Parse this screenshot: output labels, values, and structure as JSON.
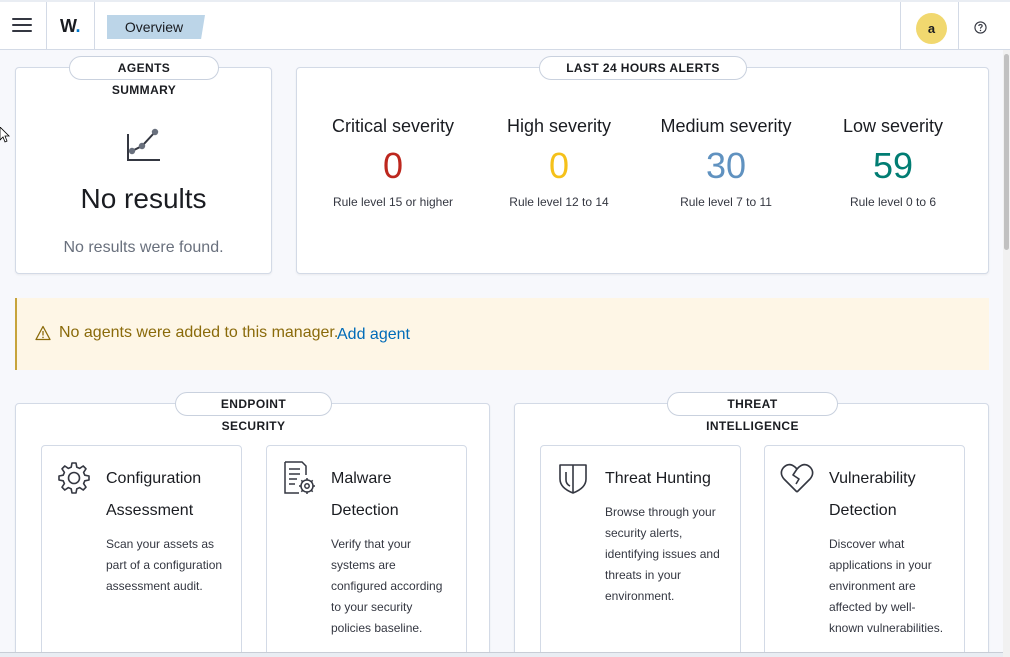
{
  "header": {
    "logo": "W",
    "logo_dot": ".",
    "breadcrumb": "Overview",
    "avatar_initial": "a",
    "menu_icon": "hamburger-icon",
    "help_icon": "help-icon"
  },
  "agents_summary": {
    "title": "AGENTS SUMMARY",
    "icon": "chart-line-icon",
    "heading": "No results",
    "message": "No results were found."
  },
  "alerts": {
    "title": "LAST 24 HOURS ALERTS",
    "items": [
      {
        "label": "Critical severity",
        "value": "0",
        "desc": "Rule level 15 or higher",
        "color": "#bd271e"
      },
      {
        "label": "High severity",
        "value": "0",
        "desc": "Rule level 12 to 14",
        "color": "#f5c11a"
      },
      {
        "label": "Medium severity",
        "value": "30",
        "desc": "Rule level 7 to 11",
        "color": "#6092c0"
      },
      {
        "label": "Low severity",
        "value": "59",
        "desc": "Rule level 0 to 6",
        "color": "#017d73"
      }
    ]
  },
  "callout": {
    "icon": "warning-icon",
    "text": "No agents were added to this manager.",
    "link": "Add agent"
  },
  "endpoint_security": {
    "title": "ENDPOINT SECURITY",
    "cards": [
      {
        "title_line1": "Configuration",
        "title_line2": "Assessment",
        "icon": "gear-icon",
        "desc": [
          "Scan your assets as",
          "part of a configuration",
          "assessment audit."
        ]
      },
      {
        "title_line1": "Malware",
        "title_line2": "Detection",
        "icon": "document-gear-icon",
        "desc": [
          "Verify that your",
          "systems are",
          "configured according",
          "to your security",
          "policies baseline."
        ]
      }
    ]
  },
  "threat_intelligence": {
    "title": "THREAT INTELLIGENCE",
    "cards": [
      {
        "title_line1": "Threat Hunting",
        "icon": "shield-icon",
        "desc": [
          "Browse through your",
          "security alerts,",
          "identifying issues and",
          "threats in your",
          "environment."
        ]
      },
      {
        "title_line1": "Vulnerability",
        "title_line2": "Detection",
        "icon": "heart-broken-icon",
        "desc": [
          "Discover what",
          "applications in your",
          "environment are",
          "affected by well-",
          "known vulnerabilities."
        ]
      }
    ]
  }
}
